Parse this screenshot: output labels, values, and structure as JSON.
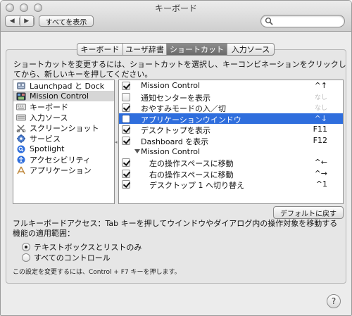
{
  "window": {
    "title": "キーボード"
  },
  "toolbar": {
    "back_glyph": "◀",
    "forward_glyph": "▶",
    "show_all_label": "すべてを表示",
    "search_value": "",
    "search_placeholder": ""
  },
  "tabs": [
    {
      "label": "キーボード",
      "active": false
    },
    {
      "label": "ユーザ辞書",
      "active": false
    },
    {
      "label": "ショートカット",
      "active": true
    },
    {
      "label": "入力ソース",
      "active": false
    }
  ],
  "instructions": "ショートカットを変更するには、ショートカットを選択し、キーコンビネーションをクリックしてから、新しいキーを押してください。",
  "categories": [
    {
      "label": "Launchpad と Dock",
      "icon": "launchpad-icon"
    },
    {
      "label": "Mission Control",
      "icon": "mission-control-icon"
    },
    {
      "label": "キーボード",
      "icon": "keyboard-icon"
    },
    {
      "label": "入力ソース",
      "icon": "input-source-icon"
    },
    {
      "label": "スクリーンショット",
      "icon": "screenshot-icon"
    },
    {
      "label": "サービス",
      "icon": "services-gear-icon"
    },
    {
      "label": "Spotlight",
      "icon": "spotlight-icon"
    },
    {
      "label": "アクセシビリティ",
      "icon": "accessibility-icon"
    },
    {
      "label": "アプリケーション",
      "icon": "applications-icon"
    }
  ],
  "selected_category": "Mission Control",
  "shortcuts": [
    {
      "label": "Mission Control",
      "key": "^↑",
      "checked": true,
      "indent": 0,
      "group": false,
      "dim": false
    },
    {
      "label": "通知センターを表示",
      "key": "なし",
      "checked": false,
      "indent": 0,
      "group": false,
      "dim": true
    },
    {
      "label": "おやすみモードの入／切",
      "key": "なし",
      "checked": true,
      "indent": 0,
      "group": false,
      "dim": true
    },
    {
      "label": "アプリケーションウインドウ",
      "key": "^↓",
      "checked": false,
      "indent": 0,
      "group": false,
      "dim": false,
      "selected": true
    },
    {
      "label": "デスクトップを表示",
      "key": "F11",
      "checked": true,
      "indent": 0,
      "group": false,
      "dim": false
    },
    {
      "label": "Dashboard を表示",
      "key": "F12",
      "checked": true,
      "indent": 0,
      "group": false,
      "dim": false
    },
    {
      "label": "Mission Control",
      "key": "",
      "checked": false,
      "indent": 0,
      "group": true,
      "dim": false
    },
    {
      "label": "左の操作スペースに移動",
      "key": "^←",
      "checked": true,
      "indent": 1,
      "group": false,
      "dim": false
    },
    {
      "label": "右の操作スペースに移動",
      "key": "^→",
      "checked": true,
      "indent": 1,
      "group": false,
      "dim": false
    },
    {
      "label": "デスクトップ 1 へ切り替え",
      "key": "^1",
      "checked": true,
      "indent": 1,
      "group": false,
      "dim": false
    }
  ],
  "restore_defaults_label": "デフォルトに戻す",
  "full_keyboard_access": "フルキーボードアクセス：Tab キーを押してウインドウやダイアログ内の操作対象を移動する機能の適用範囲：",
  "radio_options": [
    {
      "label": "テキストボックスとリストのみ",
      "checked": true
    },
    {
      "label": "すべてのコントロール",
      "checked": false
    }
  ],
  "note": "この設定を変更するには、Control + F7 キーを押します。",
  "help_glyph": "?"
}
